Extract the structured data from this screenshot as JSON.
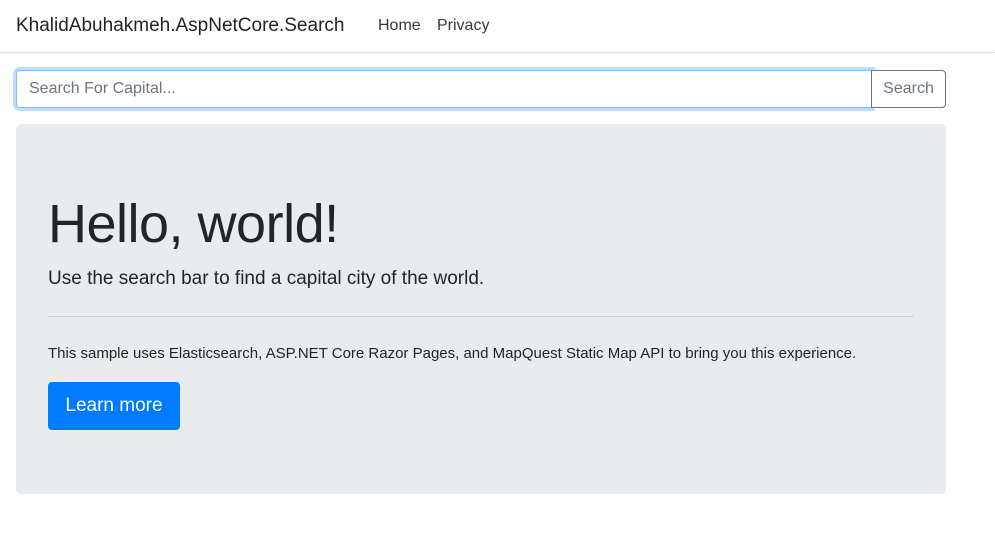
{
  "navbar": {
    "brand": "KhalidAbuhakmeh.AspNetCore.Search",
    "links": [
      {
        "label": "Home"
      },
      {
        "label": "Privacy"
      }
    ]
  },
  "search": {
    "placeholder": "Search For Capital...",
    "value": "",
    "button_label": "Search"
  },
  "jumbotron": {
    "title": "Hello, world!",
    "lead": "Use the search bar to find a capital city of the world.",
    "description": "This sample uses Elasticsearch, ASP.NET Core Razor Pages, and MapQuest Static Map API to bring you this experience.",
    "button_label": "Learn more"
  },
  "colors": {
    "primary": "#007bff",
    "jumbotron_bg": "#e9ecef",
    "focus_border": "#80bdff",
    "secondary": "#6c757d"
  }
}
